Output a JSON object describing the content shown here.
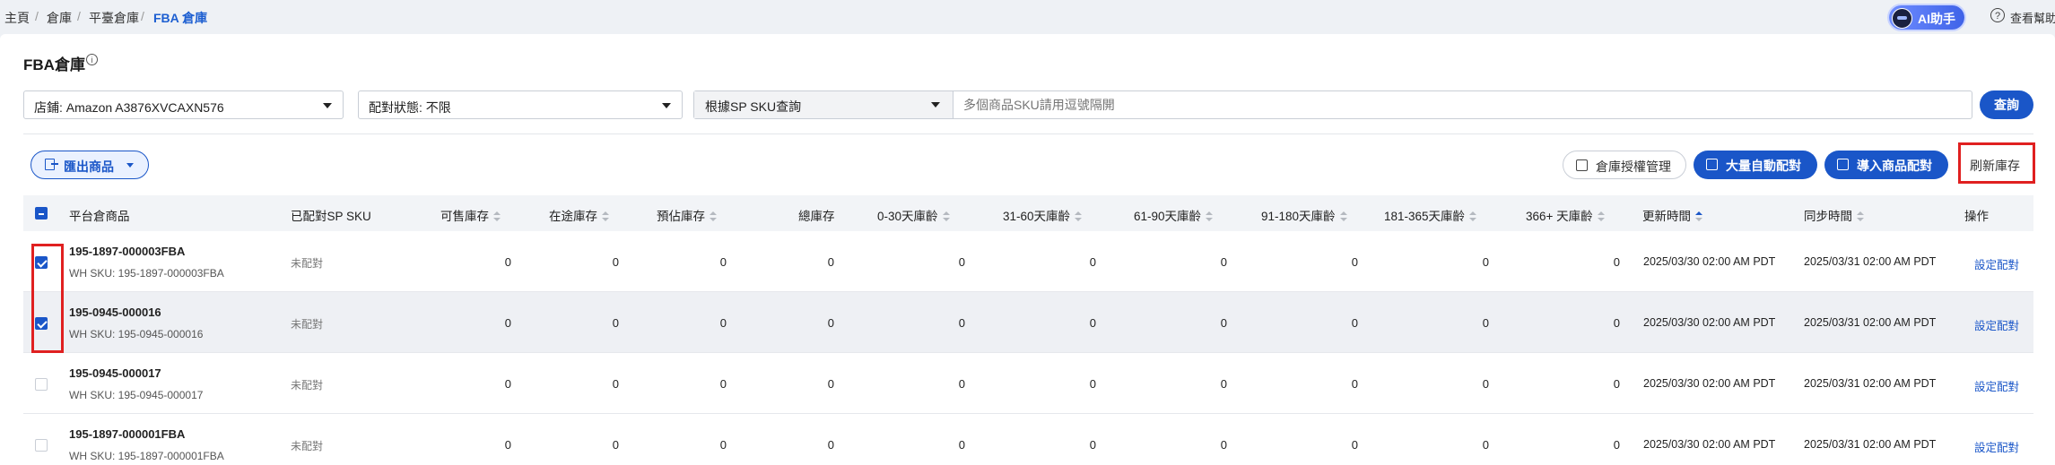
{
  "breadcrumb": [
    "主頁",
    "倉庫",
    "平臺倉庫",
    "FBA 倉庫"
  ],
  "topbar": {
    "ai_label": "AI助手",
    "help_label": "查看幫助"
  },
  "page": {
    "title": "FBA倉庫"
  },
  "filters": {
    "store": "店鋪: Amazon A3876XVCAXN576",
    "match_status": "配對狀態: 不限",
    "search_type": "根據SP SKU查詢",
    "search_placeholder": "多個商品SKU請用逗號隔開",
    "query_label": "查詢"
  },
  "toolbar": {
    "export_label": "匯出商品",
    "auth_label": "倉庫授權管理",
    "auto_match_label": "大量自動配對",
    "import_match_label": "導入商品配對",
    "refresh_label": "刷新庫存"
  },
  "table": {
    "headers": {
      "product": "平台倉商品",
      "matched": "已配對SP SKU",
      "sellable": "可售庫存",
      "inbound": "在途庫存",
      "reserved": "預佔庫存",
      "total": "總庫存",
      "age_0_30": "0-30天庫齡",
      "age_31_60": "31-60天庫齡",
      "age_61_90": "61-90天庫齡",
      "age_91_180": "91-180天庫齡",
      "age_181_365": "181-365天庫齡",
      "age_366": "366+ 天庫齡",
      "updated": "更新時間",
      "synced": "同步時間",
      "action": "操作"
    },
    "rows": [
      {
        "sku": "195-1897-000003FBA",
        "wh_sku": "WH SKU: 195-1897-000003FBA",
        "matched": "未配對",
        "values": [
          "0",
          "0",
          "0",
          "0",
          "0",
          "0",
          "0",
          "0",
          "0",
          "0"
        ],
        "updated": "2025/03/30 02:00 AM PDT",
        "synced": "2025/03/31 02:00 AM PDT",
        "action": "設定配對",
        "checked": true
      },
      {
        "sku": "195-0945-000016",
        "wh_sku": "WH SKU: 195-0945-000016",
        "matched": "未配對",
        "values": [
          "0",
          "0",
          "0",
          "0",
          "0",
          "0",
          "0",
          "0",
          "0",
          "0"
        ],
        "updated": "2025/03/30 02:00 AM PDT",
        "synced": "2025/03/31 02:00 AM PDT",
        "action": "設定配對",
        "checked": true
      },
      {
        "sku": "195-0945-000017",
        "wh_sku": "WH SKU: 195-0945-000017",
        "matched": "未配對",
        "values": [
          "0",
          "0",
          "0",
          "0",
          "0",
          "0",
          "0",
          "0",
          "0",
          "0"
        ],
        "updated": "2025/03/30 02:00 AM PDT",
        "synced": "2025/03/31 02:00 AM PDT",
        "action": "設定配對",
        "checked": false
      },
      {
        "sku": "195-1897-000001FBA",
        "wh_sku": "WH SKU: 195-1897-000001FBA",
        "matched": "未配對",
        "values": [
          "0",
          "0",
          "0",
          "0",
          "0",
          "0",
          "0",
          "0",
          "0",
          "0"
        ],
        "updated": "2025/03/30 02:00 AM PDT",
        "synced": "2025/03/31 02:00 AM PDT",
        "action": "設定配對",
        "checked": false
      }
    ]
  },
  "colors": {
    "accent": "#1a56c8",
    "highlight": "#e02020",
    "row_selected": "#eef0f4"
  }
}
